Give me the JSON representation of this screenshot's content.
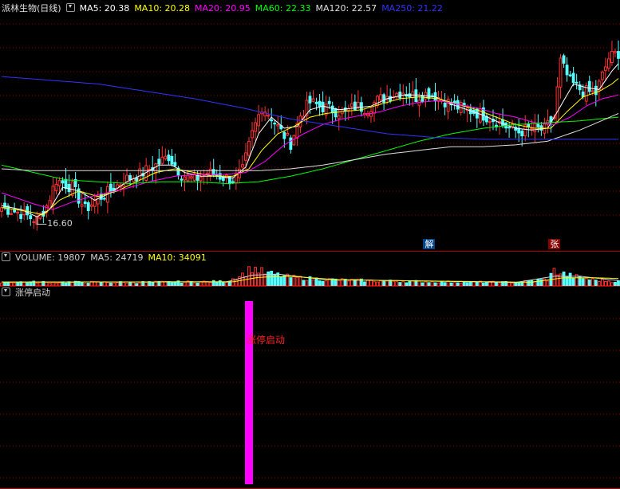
{
  "price_panel": {
    "stock_name": "派林生物(日线)",
    "ma_legend": [
      {
        "label": "MA5: 20.38",
        "color": "#ffffff"
      },
      {
        "label": "MA10: 20.28",
        "color": "#ffff00"
      },
      {
        "label": "MA20: 20.95",
        "color": "#ff00ff"
      },
      {
        "label": "MA60: 22.33",
        "color": "#00ff00"
      },
      {
        "label": "MA120: 22.57",
        "color": "#e0e0e0"
      },
      {
        "label": "MA250: 21.22",
        "color": "#3333ff"
      }
    ],
    "low_marker": "16.60",
    "event_marks": [
      {
        "text": "解",
        "index": 133,
        "bg": "#004488",
        "color": "#ffffff"
      },
      {
        "text": "张",
        "index": 172,
        "bg": "#880000",
        "color": "#ffffff"
      }
    ]
  },
  "volume_panel": {
    "legend": [
      {
        "label": "VOLUME: 19807",
        "color": "#d0d0d0"
      },
      {
        "label": "MA5: 24719",
        "color": "#d0d0d0"
      },
      {
        "label": "MA10: 34091",
        "color": "#ffff00"
      }
    ]
  },
  "signal_panel": {
    "title": "涨停启动",
    "signal_label": "涨停启动",
    "signal_index": 77
  },
  "colors": {
    "up": "#ff3030",
    "down": "#54ffff",
    "grid": "#800000",
    "signal_bar": "#ff00ff"
  },
  "chart_data": [
    {
      "type": "line",
      "title": "派林生物(日线)",
      "x_count": 193,
      "ylim": [
        15.8,
        27.8
      ],
      "series": [
        {
          "name": "MA5",
          "color": "#ffffff"
        },
        {
          "name": "MA10",
          "color": "#ffff00"
        },
        {
          "name": "MA20",
          "color": "#ff00ff"
        },
        {
          "name": "MA60",
          "color": "#00ff00"
        },
        {
          "name": "MA120",
          "color": "#e0e0e0"
        },
        {
          "name": "MA250",
          "color": "#3333ff"
        }
      ],
      "anchors": {
        "close": [
          [
            0,
            17.5
          ],
          [
            6,
            17.2
          ],
          [
            11,
            16.8
          ],
          [
            14,
            17.6
          ],
          [
            17,
            19.0
          ],
          [
            22,
            18.6
          ],
          [
            26,
            17.4
          ],
          [
            30,
            18.0
          ],
          [
            34,
            18.4
          ],
          [
            38,
            19.0
          ],
          [
            43,
            19.3
          ],
          [
            48,
            19.8
          ],
          [
            52,
            20.3
          ],
          [
            56,
            19.3
          ],
          [
            60,
            19.0
          ],
          [
            64,
            19.4
          ],
          [
            68,
            19.2
          ],
          [
            72,
            19.0
          ],
          [
            75,
            19.5
          ],
          [
            78,
            21.5
          ],
          [
            81,
            23.0
          ],
          [
            84,
            22.4
          ],
          [
            87,
            21.6
          ],
          [
            90,
            21.0
          ],
          [
            93,
            22.5
          ],
          [
            96,
            23.2
          ],
          [
            99,
            23.0
          ],
          [
            103,
            22.8
          ],
          [
            107,
            22.6
          ],
          [
            110,
            23.0
          ],
          [
            114,
            22.9
          ],
          [
            117,
            23.3
          ],
          [
            121,
            23.6
          ],
          [
            125,
            23.8
          ],
          [
            129,
            23.5
          ],
          [
            133,
            23.7
          ],
          [
            137,
            23.4
          ],
          [
            141,
            23.0
          ],
          [
            145,
            22.8
          ],
          [
            149,
            22.6
          ],
          [
            153,
            22.3
          ],
          [
            157,
            21.9
          ],
          [
            161,
            21.6
          ],
          [
            165,
            21.8
          ],
          [
            169,
            21.7
          ],
          [
            172,
            22.4
          ],
          [
            174,
            25.4
          ],
          [
            177,
            24.3
          ],
          [
            181,
            23.8
          ],
          [
            185,
            23.7
          ],
          [
            189,
            25.6
          ],
          [
            192,
            25.9
          ]
        ],
        "ma5": [
          [
            0,
            17.6
          ],
          [
            6,
            17.4
          ],
          [
            11,
            17.0
          ],
          [
            15,
            17.4
          ],
          [
            19,
            18.6
          ],
          [
            24,
            18.4
          ],
          [
            29,
            17.9
          ],
          [
            34,
            18.3
          ],
          [
            39,
            18.9
          ],
          [
            44,
            19.3
          ],
          [
            49,
            19.8
          ],
          [
            53,
            19.8
          ],
          [
            57,
            19.4
          ],
          [
            62,
            19.2
          ],
          [
            67,
            19.2
          ],
          [
            72,
            19.1
          ],
          [
            76,
            19.7
          ],
          [
            80,
            21.5
          ],
          [
            84,
            22.4
          ],
          [
            88,
            21.8
          ],
          [
            92,
            21.9
          ],
          [
            96,
            22.8
          ],
          [
            100,
            23.0
          ],
          [
            105,
            22.8
          ],
          [
            110,
            22.9
          ],
          [
            115,
            23.0
          ],
          [
            120,
            23.4
          ],
          [
            125,
            23.6
          ],
          [
            130,
            23.6
          ],
          [
            135,
            23.5
          ],
          [
            140,
            23.1
          ],
          [
            145,
            22.8
          ],
          [
            150,
            22.5
          ],
          [
            155,
            22.1
          ],
          [
            160,
            21.8
          ],
          [
            165,
            21.7
          ],
          [
            170,
            21.8
          ],
          [
            174,
            23.0
          ],
          [
            178,
            24.2
          ],
          [
            182,
            24.0
          ],
          [
            186,
            23.9
          ],
          [
            190,
            24.9
          ],
          [
            192,
            25.3
          ]
        ],
        "ma10": [
          [
            0,
            17.5
          ],
          [
            8,
            17.3
          ],
          [
            13,
            17.1
          ],
          [
            18,
            17.9
          ],
          [
            24,
            18.4
          ],
          [
            30,
            18.1
          ],
          [
            36,
            18.4
          ],
          [
            42,
            18.9
          ],
          [
            48,
            19.4
          ],
          [
            54,
            19.6
          ],
          [
            60,
            19.4
          ],
          [
            66,
            19.2
          ],
          [
            72,
            19.2
          ],
          [
            77,
            19.6
          ],
          [
            81,
            20.6
          ],
          [
            86,
            21.5
          ],
          [
            91,
            21.9
          ],
          [
            96,
            22.4
          ],
          [
            101,
            22.6
          ],
          [
            106,
            22.7
          ],
          [
            112,
            22.8
          ],
          [
            118,
            23.1
          ],
          [
            124,
            23.4
          ],
          [
            130,
            23.5
          ],
          [
            136,
            23.4
          ],
          [
            142,
            23.1
          ],
          [
            148,
            22.8
          ],
          [
            154,
            22.4
          ],
          [
            160,
            22.0
          ],
          [
            166,
            21.8
          ],
          [
            171,
            21.8
          ],
          [
            176,
            22.7
          ],
          [
            181,
            23.5
          ],
          [
            186,
            23.8
          ],
          [
            190,
            24.2
          ],
          [
            192,
            24.5
          ]
        ],
        "ma20": [
          [
            0,
            18.3
          ],
          [
            10,
            17.7
          ],
          [
            16,
            17.4
          ],
          [
            22,
            17.8
          ],
          [
            30,
            18.2
          ],
          [
            38,
            18.5
          ],
          [
            46,
            18.9
          ],
          [
            54,
            19.2
          ],
          [
            62,
            19.3
          ],
          [
            70,
            19.3
          ],
          [
            76,
            19.4
          ],
          [
            82,
            20.0
          ],
          [
            88,
            20.9
          ],
          [
            94,
            21.5
          ],
          [
            100,
            22.0
          ],
          [
            106,
            22.3
          ],
          [
            112,
            22.5
          ],
          [
            118,
            22.7
          ],
          [
            124,
            23.0
          ],
          [
            130,
            23.2
          ],
          [
            136,
            23.3
          ],
          [
            142,
            23.1
          ],
          [
            148,
            22.9
          ],
          [
            154,
            22.6
          ],
          [
            160,
            22.4
          ],
          [
            166,
            22.1
          ],
          [
            172,
            22.0
          ],
          [
            177,
            22.4
          ],
          [
            182,
            23.0
          ],
          [
            187,
            23.4
          ],
          [
            192,
            23.6
          ]
        ],
        "ma60": [
          [
            0,
            19.8
          ],
          [
            10,
            19.4
          ],
          [
            20,
            19.0
          ],
          [
            30,
            18.9
          ],
          [
            40,
            18.8
          ],
          [
            50,
            18.9
          ],
          [
            60,
            18.9
          ],
          [
            70,
            18.8
          ],
          [
            80,
            18.9
          ],
          [
            90,
            19.2
          ],
          [
            100,
            19.6
          ],
          [
            110,
            20.1
          ],
          [
            120,
            20.6
          ],
          [
            130,
            21.1
          ],
          [
            140,
            21.5
          ],
          [
            150,
            21.8
          ],
          [
            160,
            22.0
          ],
          [
            170,
            22.1
          ],
          [
            180,
            22.2
          ],
          [
            192,
            22.4
          ]
        ],
        "ma120": [
          [
            0,
            19.6
          ],
          [
            10,
            19.5
          ],
          [
            20,
            19.5
          ],
          [
            30,
            19.5
          ],
          [
            40,
            19.5
          ],
          [
            50,
            19.5
          ],
          [
            60,
            19.5
          ],
          [
            70,
            19.5
          ],
          [
            80,
            19.5
          ],
          [
            90,
            19.6
          ],
          [
            100,
            19.8
          ],
          [
            110,
            20.1
          ],
          [
            120,
            20.4
          ],
          [
            130,
            20.6
          ],
          [
            140,
            20.8
          ],
          [
            150,
            20.8
          ],
          [
            160,
            20.9
          ],
          [
            170,
            21.1
          ],
          [
            180,
            21.7
          ],
          [
            192,
            22.6
          ]
        ],
        "ma250": [
          [
            0,
            24.6
          ],
          [
            15,
            24.4
          ],
          [
            30,
            24.2
          ],
          [
            45,
            23.8
          ],
          [
            60,
            23.4
          ],
          [
            75,
            22.9
          ],
          [
            90,
            22.3
          ],
          [
            105,
            21.9
          ],
          [
            120,
            21.5
          ],
          [
            135,
            21.3
          ],
          [
            150,
            21.2
          ],
          [
            165,
            21.2
          ],
          [
            180,
            21.2
          ],
          [
            192,
            21.2
          ]
        ]
      }
    },
    {
      "type": "bar",
      "title": "VOLUME",
      "ylim": [
        0,
        100000
      ],
      "anchors": [
        [
          0,
          18000
        ],
        [
          40,
          16000
        ],
        [
          70,
          20000
        ],
        [
          76,
          60000
        ],
        [
          78,
          85000
        ],
        [
          82,
          60000
        ],
        [
          90,
          40000
        ],
        [
          100,
          30000
        ],
        [
          120,
          22000
        ],
        [
          140,
          18000
        ],
        [
          160,
          16000
        ],
        [
          170,
          30000
        ],
        [
          172,
          70000
        ],
        [
          176,
          50000
        ],
        [
          184,
          28000
        ],
        [
          192,
          20000
        ]
      ],
      "ma5_anchors": [
        [
          0,
          18000
        ],
        [
          70,
          19000
        ],
        [
          78,
          50000
        ],
        [
          86,
          55000
        ],
        [
          100,
          30000
        ],
        [
          160,
          16000
        ],
        [
          172,
          45000
        ],
        [
          180,
          45000
        ],
        [
          192,
          24719
        ]
      ],
      "ma10_anchors": [
        [
          0,
          18000
        ],
        [
          72,
          19000
        ],
        [
          80,
          40000
        ],
        [
          90,
          45000
        ],
        [
          105,
          28000
        ],
        [
          165,
          17000
        ],
        [
          175,
          38000
        ],
        [
          185,
          38000
        ],
        [
          192,
          34091
        ]
      ]
    }
  ]
}
